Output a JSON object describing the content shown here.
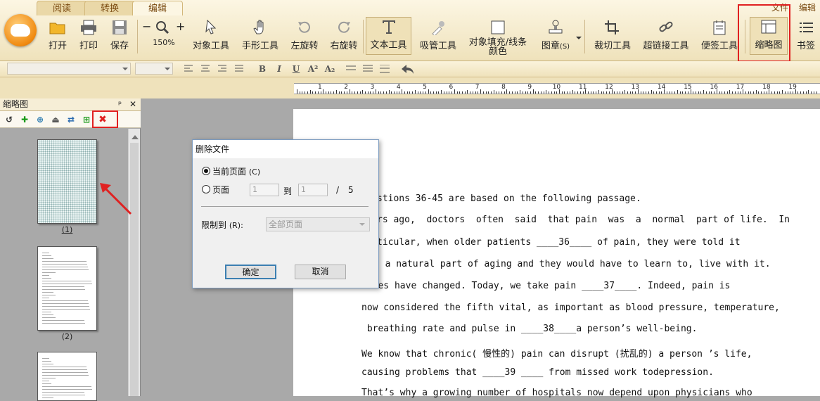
{
  "ribbon": {
    "tabs": [
      "阅读",
      "转换",
      "编辑"
    ],
    "active_tab": "编辑",
    "top_right": [
      "文件",
      "编辑"
    ],
    "tools": {
      "open": "打开",
      "print": "打印",
      "save": "保存",
      "zoom_out": "−",
      "zoom_in": "+",
      "zoom_value": "150%",
      "object_tool": "对象工具",
      "hand_tool": "手形工具",
      "rotate_left": "左旋转",
      "rotate_right": "右旋转",
      "text_tool": "文本工具",
      "eyedropper": "吸管工具",
      "fill_stroke_1": "对象填充/线条",
      "fill_stroke_2": "颜色",
      "stamp": "图章",
      "stamp_key": "(S)",
      "crop": "裁切工具",
      "hyperlink": "超链接工具",
      "note": "便签工具",
      "thumbnail": "缩略图",
      "bookmark": "书签"
    }
  },
  "format_bar": {
    "buttons": [
      "B",
      "I",
      "U",
      "A²",
      "A₂"
    ]
  },
  "ruler": {
    "numbers": [
      "1",
      "2",
      "3",
      "4",
      "5",
      "6",
      "7",
      "8",
      "9",
      "10",
      "11",
      "12",
      "13",
      "14",
      "15",
      "16",
      "17",
      "18",
      "19"
    ]
  },
  "panel": {
    "title": "缩略图",
    "pin": "ᵖ",
    "close": "✕",
    "thumbnails": [
      {
        "label": "(1)",
        "selected": true
      },
      {
        "label": "(2)",
        "selected": false
      }
    ]
  },
  "document": {
    "lines": [
      "stions 36-45 are based on the following passage.",
      "rs ago,  doctors  often  said  that pain  was  a  normal  part of life.  In",
      "ticular, when older patients ____36____ of pain, they were told it",
      "  a natural part of aging and they would have to learn to, live with it.",
      "Times have changed. Today, we take pain ____37____. Indeed, pain is",
      "now considered the fifth vital, as important as blood pressure, temperature,",
      " breathing rate and pulse in ____38____a person’s well-being.",
      "We know that chronic( 慢性的) pain can disrupt (扰乱的) a person ’s life,",
      "causing problems that ____39 ____ from missed work todepression.",
      "That’s why a growing number of hospitals now depend upon physicians who"
    ]
  },
  "dialog": {
    "title": "删除文件",
    "opt_current": "当前页面",
    "opt_current_key": "(C)",
    "opt_pages": "页面",
    "from_value": "1",
    "to_label": "到",
    "to_value": "1",
    "separator": "/",
    "total_pages": "5",
    "restrict_label": "限制到",
    "restrict_key": "(R):",
    "restrict_value": "全部页面",
    "ok": "确定",
    "cancel": "取消"
  },
  "colors": {
    "highlight": "#e02020",
    "ribbon": "#fcf6e3",
    "workspace": "#a9a9a9"
  }
}
